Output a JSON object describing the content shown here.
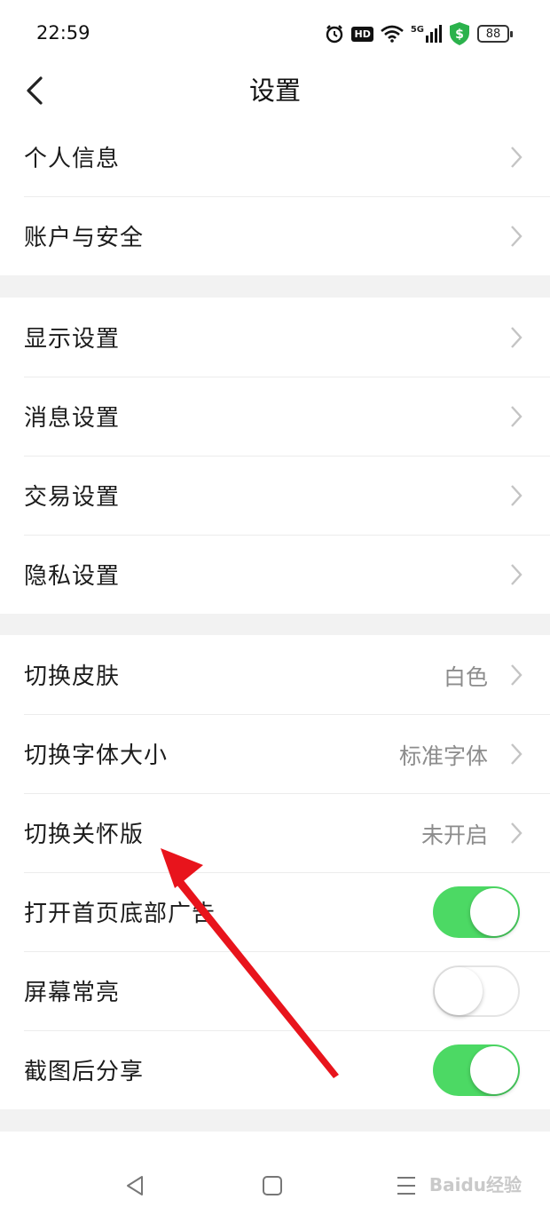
{
  "status_bar": {
    "time": "22:59",
    "hd_badge": "HD",
    "network": "5G",
    "battery": "88"
  },
  "header": {
    "title": "设置"
  },
  "groups": [
    {
      "items": [
        {
          "label": "个人信息"
        },
        {
          "label": "账户与安全"
        }
      ]
    },
    {
      "items": [
        {
          "label": "显示设置"
        },
        {
          "label": "消息设置"
        },
        {
          "label": "交易设置"
        },
        {
          "label": "隐私设置"
        }
      ]
    },
    {
      "items": [
        {
          "label": "切换皮肤",
          "value": "白色"
        },
        {
          "label": "切换字体大小",
          "value": "标准字体"
        },
        {
          "label": "切换关怀版",
          "value": "未开启"
        },
        {
          "label": "打开首页底部广告",
          "toggle": true
        },
        {
          "label": "屏幕常亮",
          "toggle": false
        },
        {
          "label": "截图后分享",
          "toggle": true
        }
      ]
    }
  ],
  "watermark": "Baidu经验",
  "colors": {
    "toggle_on": "#4cd964",
    "annotation_arrow": "#e8141c"
  }
}
